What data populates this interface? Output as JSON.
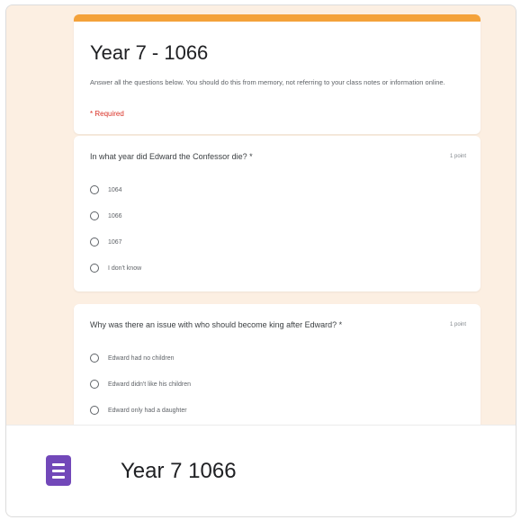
{
  "form": {
    "title": "Year 7 - 1066",
    "description": "Answer all the questions below. You should do this from memory, not referring to your class notes or information online.",
    "required_note": "* Required",
    "accent_color": "#f4a23a"
  },
  "questions": [
    {
      "text": "In what year did Edward the Confessor die? *",
      "points": "1 point",
      "options": [
        "1064",
        "1066",
        "1067",
        "I don't know"
      ]
    },
    {
      "text": "Why was there an issue with who should become king after Edward? *",
      "points": "1 point",
      "options": [
        "Edward had no children",
        "Edward didn't like his children",
        "Edward only had a daughter"
      ]
    }
  ],
  "footer": {
    "title": "Year 7 1066",
    "icon": "google-forms-icon",
    "icon_color": "#7248b9"
  }
}
